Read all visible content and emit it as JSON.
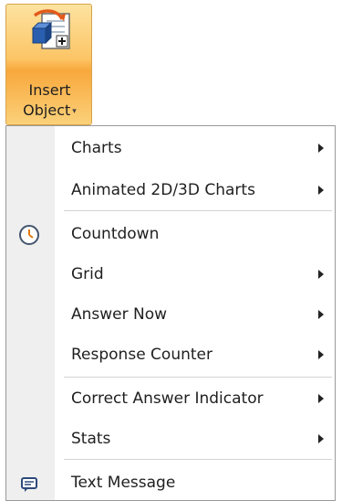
{
  "ribbon": {
    "insert_object": {
      "line1": "Insert",
      "line2": "Object",
      "icon": "insert-object-icon",
      "caret": "▾"
    }
  },
  "menu": {
    "items": [
      {
        "label": "Charts",
        "has_submenu": true
      },
      {
        "label": "Animated 2D/3D Charts",
        "has_submenu": true
      },
      {
        "label": "Countdown",
        "icon": "clock-icon",
        "has_submenu": false
      },
      {
        "label": "Grid",
        "has_submenu": true
      },
      {
        "label": "Answer Now",
        "has_submenu": true
      },
      {
        "label": "Response Counter",
        "has_submenu": true
      },
      {
        "label": "Correct Answer Indicator",
        "has_submenu": true
      },
      {
        "label": "Stats",
        "has_submenu": true
      },
      {
        "label": "Text Message",
        "icon": "message-icon",
        "has_submenu": false
      }
    ]
  },
  "colors": {
    "ribbon_highlight": "#f8a83c",
    "menu_border": "#9a9a9a",
    "icon_column": "#efefef"
  }
}
